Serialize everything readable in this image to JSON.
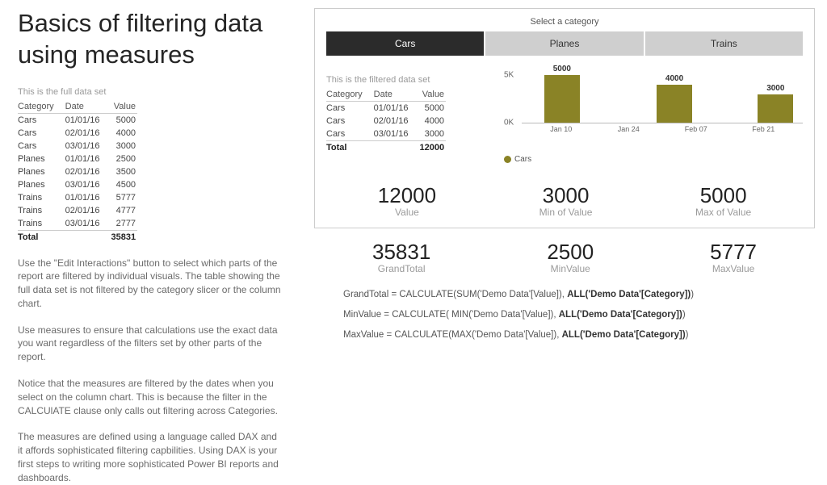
{
  "title": "Basics of filtering data using measures",
  "full_caption": "This is the full data set",
  "table_headers": {
    "category": "Category",
    "date": "Date",
    "value": "Value"
  },
  "full_table": [
    {
      "category": "Cars",
      "date": "01/01/16",
      "value": 5000
    },
    {
      "category": "Cars",
      "date": "02/01/16",
      "value": 4000
    },
    {
      "category": "Cars",
      "date": "03/01/16",
      "value": 3000
    },
    {
      "category": "Planes",
      "date": "01/01/16",
      "value": 2500
    },
    {
      "category": "Planes",
      "date": "02/01/16",
      "value": 3500
    },
    {
      "category": "Planes",
      "date": "03/01/16",
      "value": 4500
    },
    {
      "category": "Trains",
      "date": "01/01/16",
      "value": 5777
    },
    {
      "category": "Trains",
      "date": "02/01/16",
      "value": 4777
    },
    {
      "category": "Trains",
      "date": "03/01/16",
      "value": 2777
    }
  ],
  "full_total_label": "Total",
  "full_total_value": 35831,
  "paragraphs": [
    "Use the \"Edit Interactions\" button to select which parts of the report are filtered by individual visuals.  The table showing the full data set is not filtered by the category slicer or the column chart.",
    "Use measures to ensure that calculations use the exact data you want regardless of the filters set by other parts of the report.",
    "Notice that the measures are filtered by the dates when you select on the column chart.  This is because the filter in the CALCUlATE clause only calls out filtering across Categories.",
    "The measures are defined using a language called DAX and it affords sophisticated filtering capbilities.  Using DAX is your first steps to writing more sophisticated Power BI reports and dashboards."
  ],
  "slicer": {
    "title": "Select a category",
    "options": [
      "Cars",
      "Planes",
      "Trains"
    ],
    "selected": "Cars"
  },
  "filtered_caption": "This is the filtered data set",
  "filtered_table": [
    {
      "category": "Cars",
      "date": "01/01/16",
      "value": 5000
    },
    {
      "category": "Cars",
      "date": "02/01/16",
      "value": 4000
    },
    {
      "category": "Cars",
      "date": "03/01/16",
      "value": 3000
    }
  ],
  "filtered_total_label": "Total",
  "filtered_total_value": 12000,
  "chart_data": {
    "type": "bar",
    "series_name": "Cars",
    "y_ticks": [
      "5K",
      "0K"
    ],
    "ylim": [
      0,
      5000
    ],
    "x_ticks": [
      "Jan 10",
      "Jan 24",
      "Feb 07",
      "Feb 21"
    ],
    "bars": [
      {
        "label": "5000",
        "value": 5000,
        "x_pct": 8
      },
      {
        "label": "4000",
        "value": 4000,
        "x_pct": 48
      },
      {
        "label": "3000",
        "value": 3000,
        "x_pct": 84
      }
    ]
  },
  "cards_panel": [
    {
      "value": "12000",
      "label": "Value"
    },
    {
      "value": "3000",
      "label": "Min of Value"
    },
    {
      "value": "5000",
      "label": "Max of Value"
    }
  ],
  "cards_below": [
    {
      "value": "35831",
      "label": "GrandTotal"
    },
    {
      "value": "2500",
      "label": "MinValue"
    },
    {
      "value": "5777",
      "label": "MaxValue"
    }
  ],
  "dax": [
    {
      "pre": "GrandTotal = CALCULATE(SUM('Demo Data'[Value]), ",
      "bold": "ALL('Demo Data'[Category])",
      "post": ")"
    },
    {
      "pre": "MinValue = CALCULATE( MIN('Demo Data'[Value]), ",
      "bold": "ALL('Demo Data'[Category])",
      "post": ")"
    },
    {
      "pre": "MaxValue = CALCULATE(MAX('Demo Data'[Value]), ",
      "bold": "ALL('Demo Data'[Category])",
      "post": ")"
    }
  ]
}
